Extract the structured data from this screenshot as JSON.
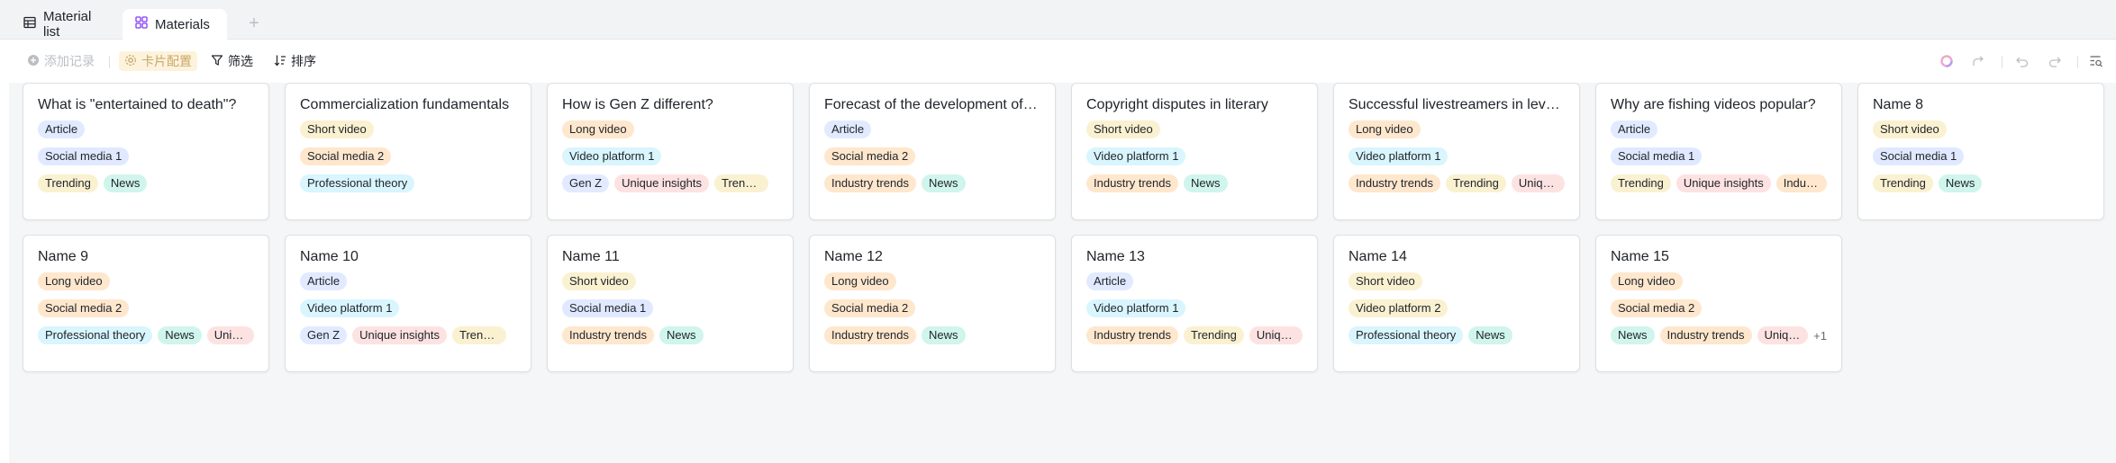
{
  "tabs": [
    {
      "label": "Material list",
      "icon": "table-icon"
    },
    {
      "label": "Materials",
      "icon": "gallery-icon"
    }
  ],
  "toolbar": {
    "add_record": "添加记录",
    "card_config": "卡片配置",
    "filter": "筛选",
    "sort": "排序"
  },
  "colors": {
    "Article": "#e1eaff",
    "Short video": "#faf1d1",
    "Long video": "#fee7cd",
    "Social media 1": "#e0e9ff",
    "Social media 2": "#fee7cd",
    "Video platform 1": "#d9f5fd",
    "Video platform 2": "#faf1d1",
    "Trending": "#faf1d1",
    "News": "#d0f5ec",
    "Professional theory": "#d9f5fd",
    "Gen Z": "#e1eaff",
    "Unique insights": "#fde2e2",
    "Industry trends": "#fee7cd"
  },
  "cards": [
    {
      "title": "What is \"entertained to death\"?",
      "type": [
        "Article"
      ],
      "platform": [
        "Social media 1"
      ],
      "tags": [
        "Trending",
        "News"
      ]
    },
    {
      "title": "Commercialization fundamentals",
      "type": [
        "Short video"
      ],
      "platform": [
        "Social media 2"
      ],
      "tags": [
        "Professional theory"
      ]
    },
    {
      "title": "How is Gen Z different?",
      "type": [
        "Long video"
      ],
      "platform": [
        "Video platform 1"
      ],
      "tags": [
        "Gen Z",
        "Unique insights",
        "Trending"
      ]
    },
    {
      "title": "Forecast of the development of the short video industry",
      "type": [
        "Article"
      ],
      "platform": [
        "Social media 2"
      ],
      "tags": [
        "Industry trends",
        "News"
      ]
    },
    {
      "title": "Copyright disputes in literary",
      "type": [
        "Short video"
      ],
      "platform": [
        "Video platform 1"
      ],
      "tags": [
        "Industry trends",
        "News"
      ]
    },
    {
      "title": "Successful livestreamers in level one cities",
      "type": [
        "Long video"
      ],
      "platform": [
        "Video platform 1"
      ],
      "tags": [
        "Industry trends",
        "Trending",
        "Unique insights"
      ]
    },
    {
      "title": "Why are fishing videos popular?",
      "type": [
        "Article"
      ],
      "platform": [
        "Social media 1"
      ],
      "tags": [
        "Trending",
        "Unique insights",
        "Industry trends"
      ]
    },
    {
      "title": "Name 8",
      "type": [
        "Short video"
      ],
      "platform": [
        "Social media 1"
      ],
      "tags": [
        "Trending",
        "News"
      ]
    },
    {
      "title": "Name 9",
      "type": [
        "Long video"
      ],
      "platform": [
        "Social media 2"
      ],
      "tags": [
        "Professional theory",
        "News",
        "Unique insights"
      ]
    },
    {
      "title": "Name 10",
      "type": [
        "Article"
      ],
      "platform": [
        "Video platform 1"
      ],
      "tags": [
        "Gen Z",
        "Unique insights",
        "Trending"
      ]
    },
    {
      "title": "Name 11",
      "type": [
        "Short video"
      ],
      "platform": [
        "Social media 1"
      ],
      "tags": [
        "Industry trends",
        "News"
      ]
    },
    {
      "title": "Name 12",
      "type": [
        "Long video"
      ],
      "platform": [
        "Social media 2"
      ],
      "tags": [
        "Industry trends",
        "News"
      ]
    },
    {
      "title": "Name 13",
      "type": [
        "Article"
      ],
      "platform": [
        "Video platform 1"
      ],
      "tags": [
        "Industry trends",
        "Trending",
        "Unique insights"
      ]
    },
    {
      "title": "Name 14",
      "type": [
        "Short video"
      ],
      "platform": [
        "Video platform 2"
      ],
      "tags": [
        "Professional theory",
        "News"
      ]
    },
    {
      "title": "Name 15",
      "type": [
        "Long video"
      ],
      "platform": [
        "Social media 2"
      ],
      "tags": [
        "News",
        "Industry trends",
        "Unique insights"
      ],
      "more": "+1"
    }
  ]
}
